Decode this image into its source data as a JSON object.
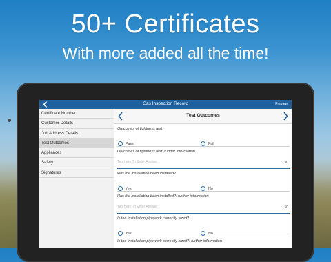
{
  "promo": {
    "headline": "50+ Certificates",
    "subline": "With more added all the time!"
  },
  "app": {
    "title": "Gas Inspection Record",
    "preview_label": "Preview",
    "section_title": "Test Outcomes"
  },
  "sidebar": {
    "items": [
      {
        "label": "Certificate Number",
        "active": false
      },
      {
        "label": "Customer Details",
        "active": false
      },
      {
        "label": "Job Address Details",
        "active": false
      },
      {
        "label": "Test Outcomes",
        "active": true
      },
      {
        "label": "Appliances",
        "active": false
      },
      {
        "label": "Safety",
        "active": false
      },
      {
        "label": "Signatures",
        "active": false
      }
    ]
  },
  "form": {
    "q1": {
      "label": "Outcomes of tightness test",
      "opt1": "Pass",
      "opt2": "Fail"
    },
    "q1_info": {
      "label": "Outcomes of tightness test: further information",
      "placeholder": "Tap Here To Enter Answer",
      "counter": "50"
    },
    "q2": {
      "label": "Has the installation been installed?",
      "opt1": "Yes",
      "opt2": "No"
    },
    "q2_info": {
      "label": "Has the installation been installed?: further information",
      "placeholder": "Tap Here To Enter Answer",
      "counter": "50"
    },
    "q3": {
      "label": "Is the installation pipework correctly sized?",
      "opt1": "Yes",
      "opt2": "No"
    },
    "q3_info": {
      "label": "Is the installation pipework correctly sized?: further information"
    }
  },
  "colors": {
    "accent": "#1e5f9c",
    "radio": "#2b6fae"
  },
  "icons": {
    "back": "chevron-left-icon",
    "prev": "chevron-left-icon",
    "next": "chevron-right-icon"
  }
}
